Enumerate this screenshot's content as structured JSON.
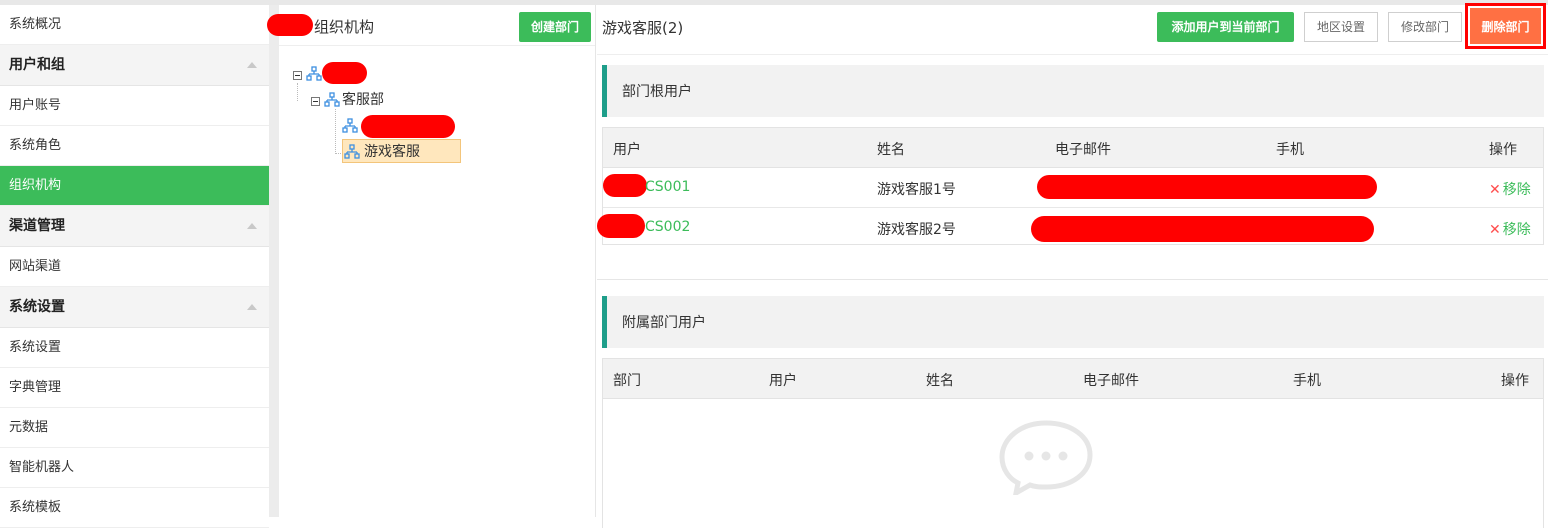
{
  "sidebar": {
    "items": [
      {
        "label": "系统概况",
        "type": "item"
      },
      {
        "label": "用户和组",
        "type": "group"
      },
      {
        "label": "用户账号",
        "type": "item"
      },
      {
        "label": "系统角色",
        "type": "item"
      },
      {
        "label": "组织机构",
        "type": "item",
        "active": true
      },
      {
        "label": "渠道管理",
        "type": "group"
      },
      {
        "label": "网站渠道",
        "type": "item"
      },
      {
        "label": "系统设置",
        "type": "group"
      },
      {
        "label": "系统设置",
        "type": "item"
      },
      {
        "label": "字典管理",
        "type": "item"
      },
      {
        "label": "元数据",
        "type": "item"
      },
      {
        "label": "智能机器人",
        "type": "item"
      },
      {
        "label": "系统模板",
        "type": "item"
      }
    ]
  },
  "tree": {
    "title": "组织机构",
    "create_button": "创建部门",
    "nodes": {
      "child1": "客服部",
      "selected": "游戏客服"
    }
  },
  "main": {
    "title": "游戏客服(2)",
    "buttons": {
      "add_user": "添加用户到当前部门",
      "region": "地区设置",
      "edit": "修改部门",
      "delete": "删除部门"
    },
    "root_users": {
      "heading": "部门根用户",
      "columns": {
        "user": "用户",
        "name": "姓名",
        "email": "电子邮件",
        "phone": "手机",
        "action": "操作"
      },
      "rows": [
        {
          "user": "CS001",
          "name": "游戏客服1号",
          "action": "移除"
        },
        {
          "user": "CS002",
          "name": "游戏客服2号",
          "action": "移除"
        }
      ]
    },
    "affiliated_users": {
      "heading": "附属部门用户",
      "columns": {
        "dept": "部门",
        "user": "用户",
        "name": "姓名",
        "email": "电子邮件",
        "phone": "手机",
        "action": "操作"
      }
    }
  },
  "colors": {
    "accent_green": "#3cbc5a",
    "delete_orange": "#ff7043",
    "section_bar": "#1e9e8a",
    "redaction": "#ff0000"
  }
}
